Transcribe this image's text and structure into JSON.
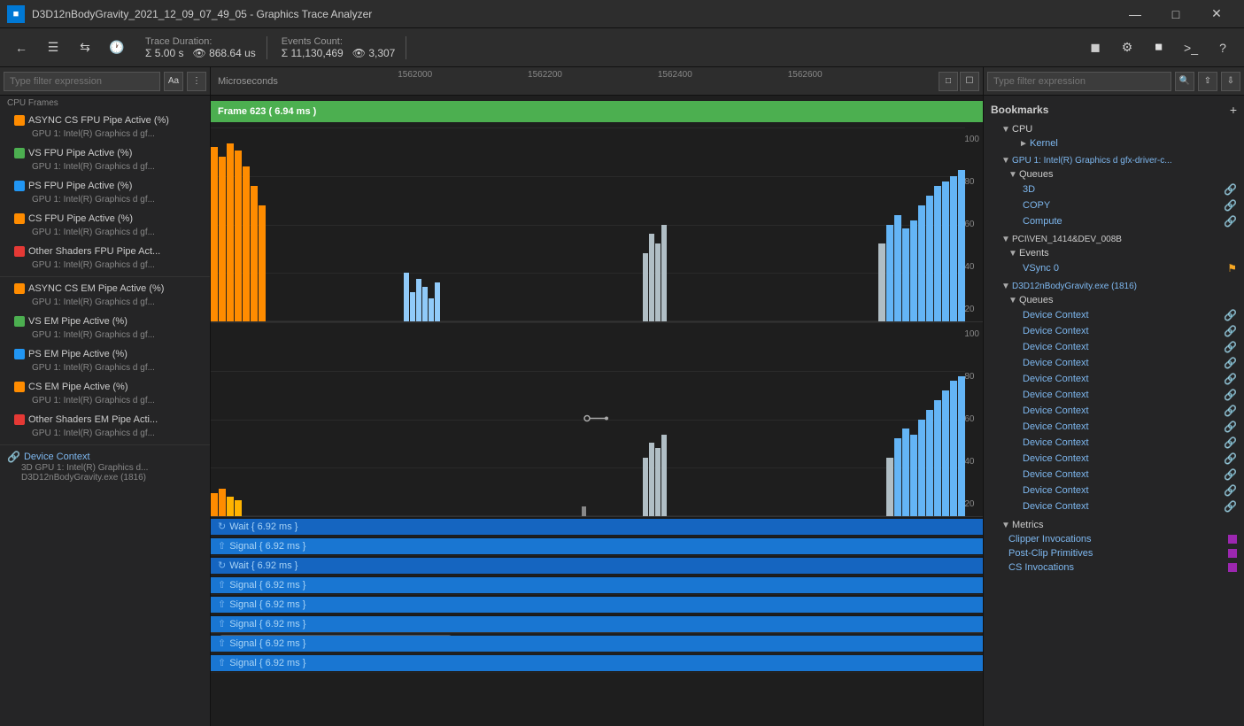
{
  "window": {
    "title": "D3D12nBodyGravity_2021_12_09_07_49_05 - Graphics Trace Analyzer",
    "icon": "GTA"
  },
  "toolbar": {
    "trace_duration_label": "Trace Duration:",
    "trace_duration_sum": "5.00 s",
    "trace_duration_eye": "868.64 us",
    "events_count_label": "Events Count:",
    "events_count_sum": "11,130,469",
    "events_count_eye": "3,307"
  },
  "filter_left": {
    "placeholder": "Type filter expression"
  },
  "filter_right": {
    "placeholder": "Type filter expression"
  },
  "timeline": {
    "label": "Microseconds",
    "ticks": [
      "1562000",
      "1562200",
      "1562400",
      "1562600"
    ]
  },
  "frame_bar": {
    "label": "Frame 623 ( 6.94 ms )"
  },
  "tracks": [
    {
      "name": "ASYNC CS FPU Pipe Active (%)",
      "sub": "GPU 1: Intel(R) Graphics d gf...",
      "color": "#FF8C00"
    },
    {
      "name": "VS FPU Pipe Active (%)",
      "sub": "GPU 1: Intel(R) Graphics d gf...",
      "color": "#4CAF50"
    },
    {
      "name": "PS FPU Pipe Active (%)",
      "sub": "GPU 1: Intel(R) Graphics d gf...",
      "color": "#2196F3"
    },
    {
      "name": "CS FPU Pipe Active (%)",
      "sub": "GPU 1: Intel(R) Graphics d gf...",
      "color": "#FF8C00"
    },
    {
      "name": "Other Shaders FPU Pipe Act...",
      "sub": "GPU 1: Intel(R) Graphics d gf...",
      "color": "#e53935"
    },
    {
      "name": "ASYNC CS EM Pipe Active (%)",
      "sub": "GPU 1: Intel(R) Graphics d gf...",
      "color": "#FF8C00"
    },
    {
      "name": "VS EM Pipe Active (%)",
      "sub": "GPU 1: Intel(R) Graphics d gf...",
      "color": "#4CAF50"
    },
    {
      "name": "PS EM Pipe Active (%)",
      "sub": "GPU 1: Intel(R) Graphics d gf...",
      "color": "#2196F3"
    },
    {
      "name": "CS EM Pipe Active (%)",
      "sub": "GPU 1: Intel(R) Graphics d gf...",
      "color": "#FF8C00"
    },
    {
      "name": "Other Shaders EM Pipe Acti...",
      "sub": "GPU 1: Intel(R) Graphics d gf...",
      "color": "#e53935"
    }
  ],
  "device_context": {
    "label": "Device Context",
    "sub1": "3D GPU 1: Intel(R) Graphics d...",
    "sub2": "D3D12nBodyGravity.exe (1816)"
  },
  "events": [
    {
      "label": "Wait { 6.92 ms }",
      "type": "wait"
    },
    {
      "label": "Signal { 6.92 ms }",
      "type": "signal"
    },
    {
      "label": "Wait { 6.92 ms }",
      "type": "wait"
    },
    {
      "label": "Signal { 6.92 ms }",
      "type": "signal"
    },
    {
      "label": "Signal { 6.92 ms }",
      "type": "signal"
    },
    {
      "label": "Signal { 6.92 ms }",
      "type": "signal"
    },
    {
      "label": "Signal { 6.92 ms }",
      "type": "signal"
    },
    {
      "label": "Signal { 6.92 ms }",
      "type": "signal"
    }
  ],
  "bookmarks": {
    "title": "Bookmarks",
    "add_label": "+",
    "sections": [
      {
        "label": "CPU",
        "expanded": true,
        "color": null,
        "children": [
          {
            "label": "Kernel",
            "expanded": false,
            "children": []
          }
        ]
      },
      {
        "label": "GPU 1: Intel(R) Graphics d gfx-driver-c...",
        "expanded": true,
        "children": [
          {
            "label": "Queues",
            "expanded": true,
            "children": [
              {
                "label": "3D",
                "link": true
              },
              {
                "label": "COPY",
                "link": true
              },
              {
                "label": "Compute",
                "link": true
              }
            ]
          }
        ]
      },
      {
        "label": "PCI\\VEN_1414&DEV_008B",
        "expanded": true,
        "children": [
          {
            "label": "Events",
            "expanded": true,
            "children": [
              {
                "label": "VSync 0",
                "flag": true
              }
            ]
          }
        ]
      },
      {
        "label": "D3D12nBodyGravity.exe (1816)",
        "expanded": true,
        "children": [
          {
            "label": "Queues",
            "expanded": true,
            "children": [
              {
                "label": "Device Context",
                "link": true
              },
              {
                "label": "Device Context",
                "link": true
              },
              {
                "label": "Device Context",
                "link": true
              },
              {
                "label": "Device Context",
                "link": true
              },
              {
                "label": "Device Context",
                "link": true
              },
              {
                "label": "Device Context",
                "link": true
              },
              {
                "label": "Device Context",
                "link": true
              },
              {
                "label": "Device Context",
                "link": true
              },
              {
                "label": "Device Context",
                "link": true
              },
              {
                "label": "Device Context",
                "link": true
              },
              {
                "label": "Device Context",
                "link": true
              },
              {
                "label": "Device Context",
                "link": true
              },
              {
                "label": "Device Context",
                "link": true
              }
            ]
          }
        ]
      },
      {
        "label": "Metrics",
        "expanded": true,
        "children": [
          {
            "label": "Clipper Invocations",
            "color": "#9C27B0"
          },
          {
            "label": "Post-Clip Primitives",
            "color": "#9C27B0"
          },
          {
            "label": "CS Invocations",
            "color": "#9C27B0"
          }
        ]
      }
    ]
  }
}
